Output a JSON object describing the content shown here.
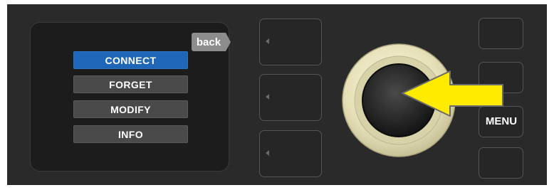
{
  "screen": {
    "back_label": "back",
    "menu_items": [
      {
        "label": "CONNECT",
        "selected": true
      },
      {
        "label": "FORGET",
        "selected": false
      },
      {
        "label": "MODIFY",
        "selected": false
      },
      {
        "label": "INFO",
        "selected": false
      }
    ]
  },
  "hardware": {
    "menu_label": "MENU",
    "encoder_icon": "rotary-encoder-knob",
    "callout_icon": "arrow-left-icon"
  },
  "colors": {
    "selected_item": "#1f66b8",
    "arrow_fill": "#ffeb00"
  }
}
